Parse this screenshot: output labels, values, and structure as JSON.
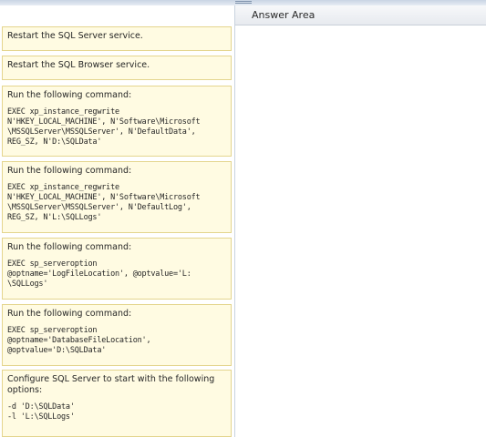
{
  "answer_area": {
    "title": "Answer Area"
  },
  "cards": [
    {
      "title": "Restart the SQL Server service.",
      "code": ""
    },
    {
      "title": "Restart the SQL Browser service.",
      "code": ""
    },
    {
      "title": "Run the following command:",
      "code": "EXEC xp_instance_regwrite\nN'HKEY_LOCAL_MACHINE', N'Software\\Microsoft\n\\MSSQLServer\\MSSQLServer', N'DefaultData',\nREG_SZ, N'D:\\SQLData'"
    },
    {
      "title": "Run the following command:",
      "code": "EXEC xp_instance_regwrite\nN'HKEY_LOCAL_MACHINE', N'Software\\Microsoft\n\\MSSQLServer\\MSSQLServer', N'DefaultLog',\nREG_SZ, N'L:\\SQLLogs'"
    },
    {
      "title": "Run the following command:",
      "code": "EXEC sp_serveroption\n@optname='LogFileLocation', @optvalue='L:\n\\SQLLogs'"
    },
    {
      "title": "Run the following command:",
      "code": "EXEC sp_serveroption\n@optname='DatabaseFileLocation',\n@optvalue='D:\\SQLData'"
    },
    {
      "title": "Configure SQL Server to start with the following options:",
      "code": "-d 'D:\\SQLData'\n-l 'L:\\SQLLogs'"
    }
  ]
}
